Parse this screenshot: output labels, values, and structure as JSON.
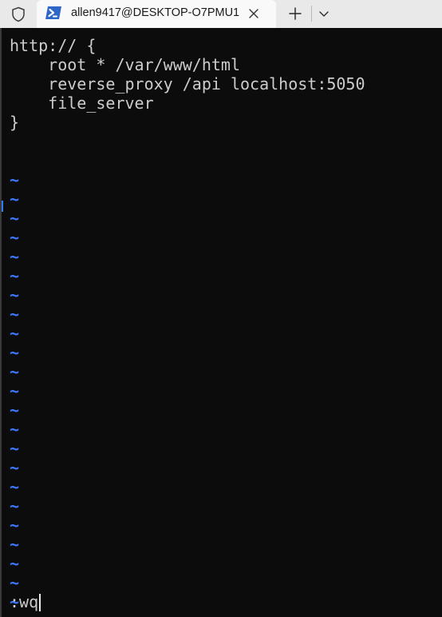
{
  "tab": {
    "title": "allen9417@DESKTOP-O7PMU1",
    "icon": "powershell-icon"
  },
  "icons": {
    "shield": "shield-icon",
    "close": "close-icon",
    "new_tab": "plus-icon",
    "dropdown": "chevron-down-icon"
  },
  "colors": {
    "terminal_bg": "#0c0c0c",
    "text": "#cccccc",
    "tilde": "#3b78ff",
    "tabbar_bg": "#e9e9e9",
    "tab_bg": "#f9f9f9",
    "powershell_blue": "#2f67c8"
  },
  "editor": {
    "lines": [
      "http:// {",
      "    root * /var/www/html",
      "    reverse_proxy /api localhost:5050",
      "    file_server",
      "}",
      "",
      "",
      "~",
      "~",
      "~",
      "~",
      "~",
      "~",
      "~",
      "~",
      "~",
      "~",
      "~",
      "~",
      "~",
      "~",
      "~",
      "~",
      "~",
      "~",
      "~",
      "~",
      "~",
      "~",
      "~"
    ],
    "command": ":wq"
  }
}
